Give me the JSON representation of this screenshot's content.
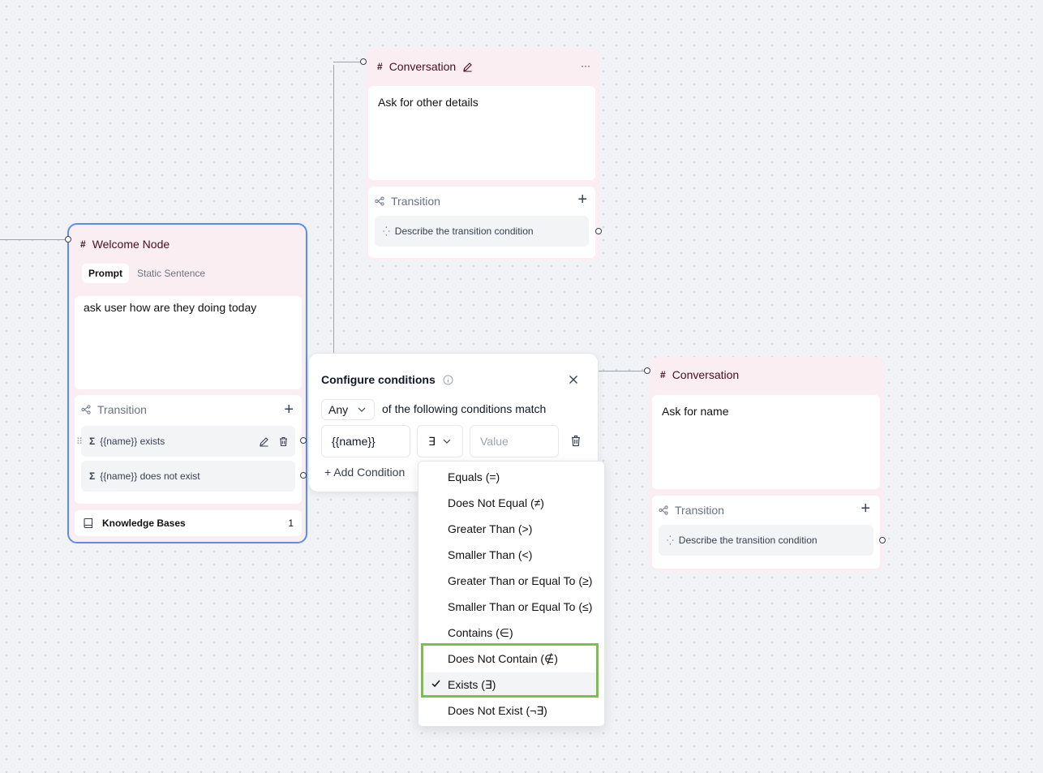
{
  "colors": {
    "node_bg": "#fbeef3",
    "node_accent": "#4a0d22",
    "selected_border": "#5b8def",
    "highlight": "#7cc04b"
  },
  "welcome_node": {
    "title": "Welcome Node",
    "tabs": [
      "Prompt",
      "Static Sentence"
    ],
    "active_tab": "Prompt",
    "prompt": "ask user how are they doing today",
    "transition": {
      "title": "Transition",
      "conditions": [
        "{{name}} exists",
        "{{name}} does not exist"
      ]
    },
    "knowledge_bases": {
      "label": "Knowledge Bases",
      "count": "1"
    }
  },
  "conversation_top": {
    "title": "Conversation",
    "more": "···",
    "prompt": "Ask for other details",
    "transition": {
      "title": "Transition",
      "placeholder": "Describe the transition condition"
    }
  },
  "conversation_right": {
    "title": "Conversation",
    "prompt": "Ask for name",
    "transition": {
      "title": "Transition",
      "placeholder": "Describe the transition condition"
    }
  },
  "configure_dialog": {
    "title": "Configure conditions",
    "match_select": "Any",
    "match_text": "of the following conditions match",
    "variable": "{{name}}",
    "operator": "∃",
    "value_placeholder": "Value",
    "add_condition": "+ Add Condition"
  },
  "operator_menu": {
    "items": [
      "Equals (=)",
      "Does Not Equal (≠)",
      "Greater Than (>)",
      "Smaller Than (<)",
      "Greater Than or Equal To (≥)",
      "Smaller Than or Equal To (≤)",
      "Contains (∈)",
      "Does Not Contain (∉)",
      "Exists (∃)",
      "Does Not Exist (¬∃)"
    ],
    "selected": "Exists (∃)"
  }
}
